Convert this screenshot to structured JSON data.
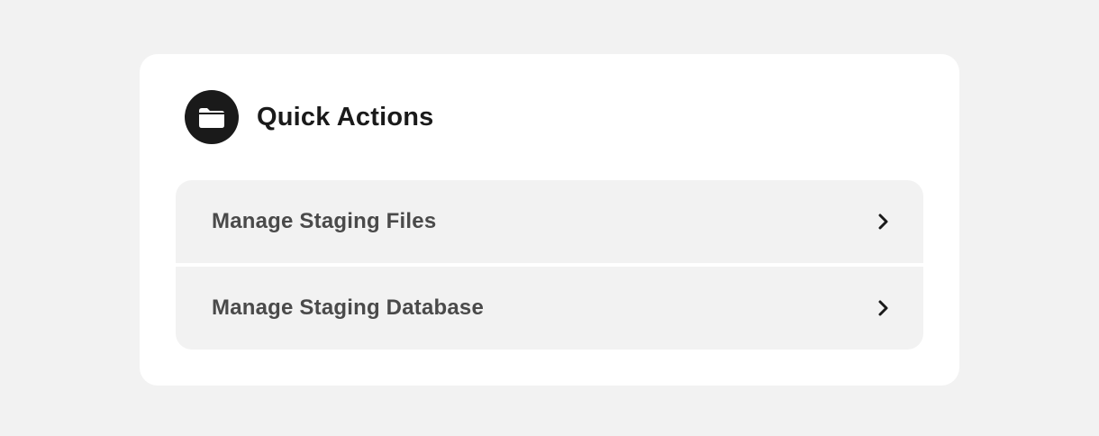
{
  "quick_actions": {
    "title": "Quick Actions",
    "header_icon": "folder-icon",
    "items": [
      {
        "label": "Manage Staging Files",
        "icon": "chevron-right-icon"
      },
      {
        "label": "Manage Staging Database",
        "icon": "chevron-right-icon"
      }
    ]
  },
  "colors": {
    "page_background": "#f2f2f2",
    "card_background": "#ffffff",
    "row_background": "#f2f2f2",
    "icon_circle": "#1a1a1a",
    "title_text": "#1a1a1a",
    "row_text": "#4a4a4a"
  }
}
